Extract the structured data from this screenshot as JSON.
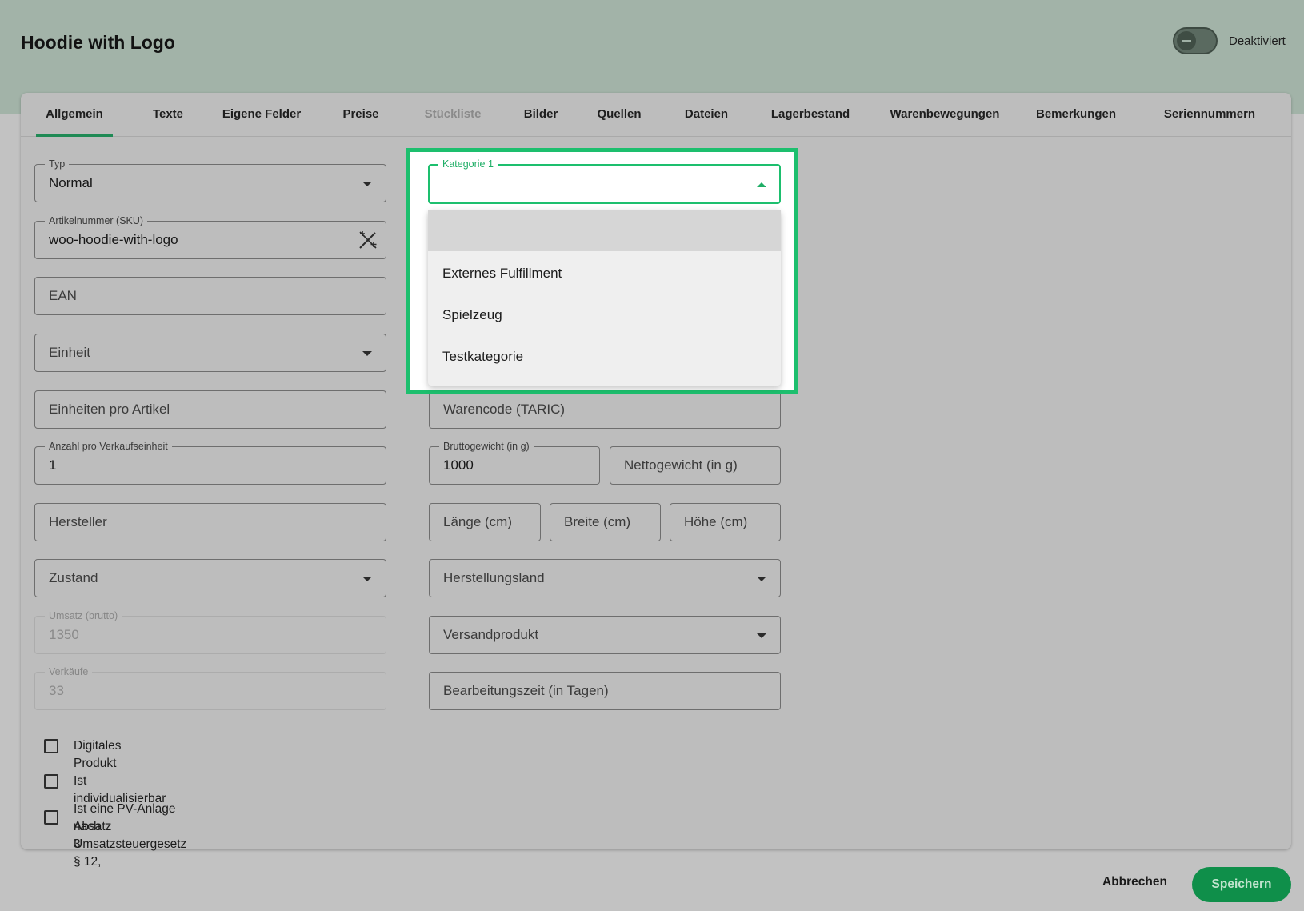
{
  "header": {
    "title": "Hoodie with Logo",
    "toggle_label": "Deaktiviert"
  },
  "tabs": [
    {
      "label": "Allgemein"
    },
    {
      "label": "Texte"
    },
    {
      "label": "Eigene Felder"
    },
    {
      "label": "Preise"
    },
    {
      "label": "Stückliste"
    },
    {
      "label": "Bilder"
    },
    {
      "label": "Quellen"
    },
    {
      "label": "Dateien"
    },
    {
      "label": "Lagerbestand"
    },
    {
      "label": "Warenbewegungen"
    },
    {
      "label": "Bemerkungen"
    },
    {
      "label": "Seriennummern"
    }
  ],
  "left": {
    "typ": {
      "label": "Typ",
      "value": "Normal"
    },
    "sku": {
      "label": "Artikelnummer (SKU)",
      "value": "woo-hoodie-with-logo"
    },
    "ean": {
      "placeholder": "EAN"
    },
    "einheit": {
      "placeholder": "Einheit"
    },
    "einheiten_pro_artikel": {
      "placeholder": "Einheiten pro Artikel"
    },
    "anzahl": {
      "label": "Anzahl pro Verkaufseinheit",
      "value": "1"
    },
    "hersteller": {
      "placeholder": "Hersteller"
    },
    "zustand": {
      "placeholder": "Zustand"
    },
    "umsatz": {
      "label": "Umsatz (brutto)",
      "value": "1350"
    },
    "verkaeufe": {
      "label": "Verkäufe",
      "value": "33"
    }
  },
  "checkboxes": [
    {
      "label": "Digitales Produkt"
    },
    {
      "label": "Ist individualisierbar"
    },
    {
      "label_line1": "Ist eine PV-Anlage nach Umsatzsteuergesetz § 12,",
      "label_line2": "Absatz 3"
    }
  ],
  "right": {
    "kategorie": {
      "label": "Kategorie 1",
      "options": [
        "",
        "Externes Fulfillment",
        "Spielzeug",
        "Testkategorie"
      ]
    },
    "warencode": {
      "placeholder": "Warencode (TARIC)"
    },
    "brutto": {
      "label": "Bruttogewicht (in g)",
      "value": "1000"
    },
    "netto": {
      "placeholder": "Nettogewicht (in g)"
    },
    "laenge": {
      "placeholder": "Länge (cm)"
    },
    "breite": {
      "placeholder": "Breite (cm)"
    },
    "hoehe": {
      "placeholder": "Höhe (cm)"
    },
    "herstellungsland": {
      "placeholder": "Herstellungsland"
    },
    "versandprodukt": {
      "placeholder": "Versandprodukt"
    },
    "bearbeitungszeit": {
      "placeholder": "Bearbeitungszeit (in Tagen)"
    }
  },
  "footer": {
    "cancel": "Abbrechen",
    "save": "Speichern"
  },
  "colors": {
    "accent": "#1dbf6e",
    "primary_button": "#0f8f4a",
    "header_band": "#a2b3a8"
  },
  "icons": {
    "sku_generate": "magic-wand-icon",
    "dropdown": "caret-down-icon"
  }
}
